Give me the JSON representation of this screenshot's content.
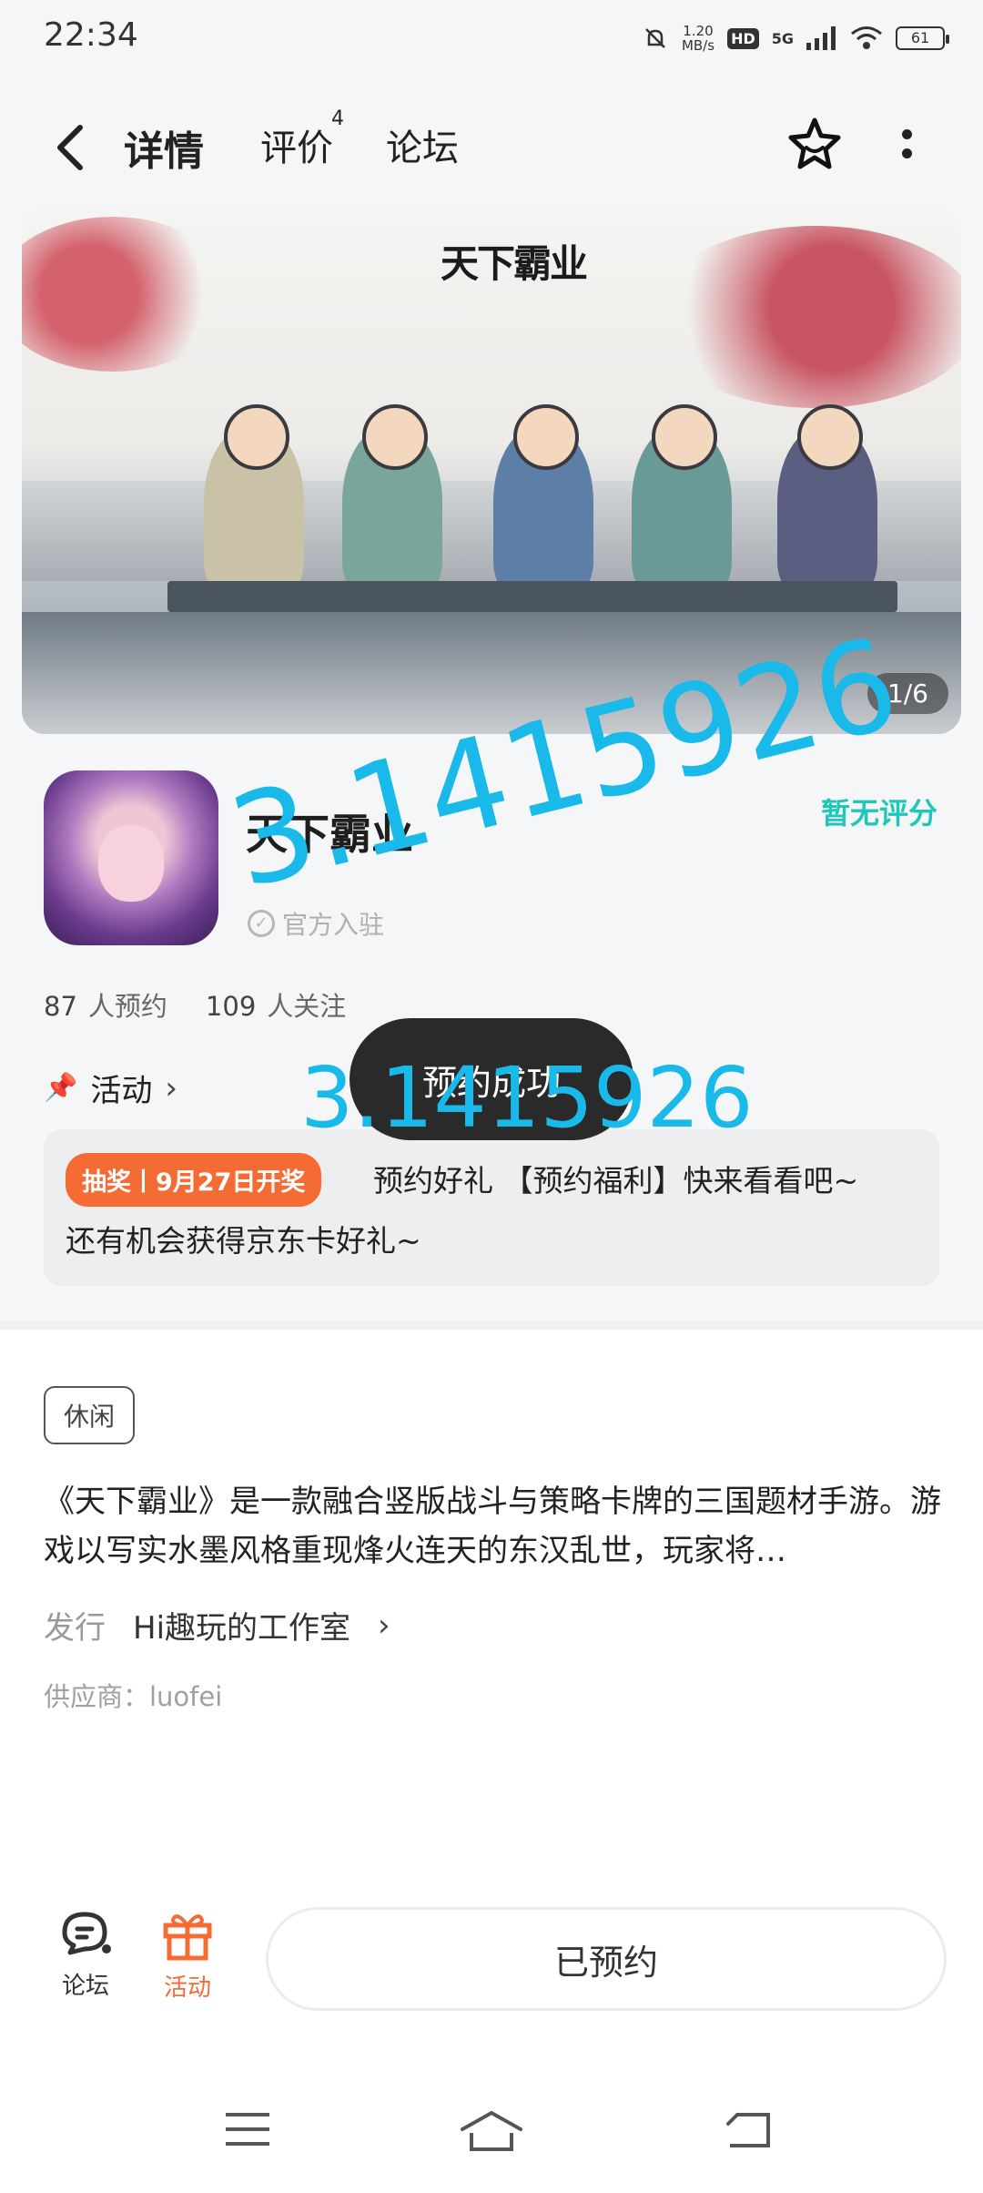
{
  "status_bar": {
    "time": "22:34",
    "net_speed_value": "1.20",
    "net_speed_unit": "MB/s",
    "hd_label": "HD",
    "network": "5G",
    "battery": "61"
  },
  "nav": {
    "tabs": [
      {
        "label": "详情",
        "active": true
      },
      {
        "label": "评价",
        "badge": "4"
      },
      {
        "label": "论坛"
      }
    ]
  },
  "banner": {
    "game_logo_text": "天下霸业",
    "pager": "1/6"
  },
  "app": {
    "name": "天下霸业",
    "official": "官方入驻",
    "rating": "暂无评分",
    "reservations_count": "87",
    "reservations_label": "人预约",
    "followers_count": "109",
    "followers_label": "人关注"
  },
  "activity": {
    "header": "活动",
    "tag": "抽奖丨9月27日开奖",
    "line1": "预约好礼 【预约福利】快来看看吧~",
    "line2": "还有机会获得京东卡好礼~"
  },
  "details": {
    "genre": "休闲",
    "description": "《天下霸业》是一款融合竖版战斗与策略卡牌的三国题材手游。游戏以写实水墨风格重现烽火连天的东汉乱世，玩家将…",
    "publisher_label": "发行",
    "publisher": "Hi趣玩的工作室",
    "supplier": "供应商：luofei"
  },
  "bottom_bar": {
    "forum_label": "论坛",
    "activity_label": "活动",
    "reserve_button": "已预约"
  },
  "toast": "预约成功",
  "overlay": {
    "large": "3.1415926",
    "small": "3.1415926"
  },
  "colors": {
    "accent_teal": "#1fc7b8",
    "accent_orange": "#f46b34",
    "overlay_blue": "#19b9ea"
  }
}
